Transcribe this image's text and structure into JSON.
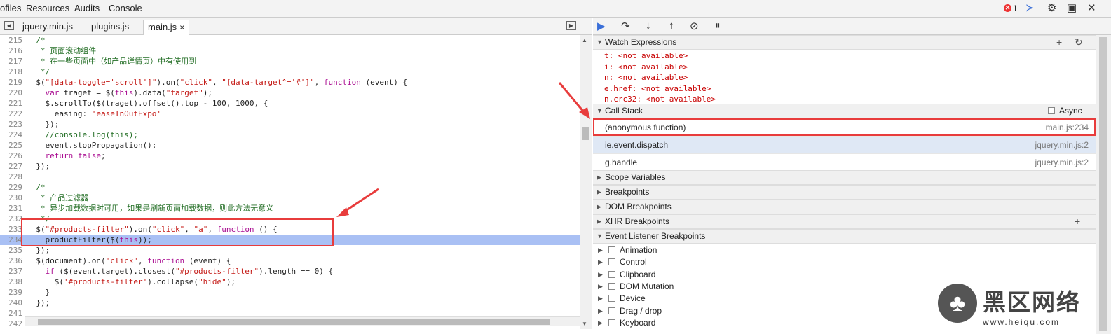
{
  "topbar": {
    "menus": [
      "ofiles",
      "Resources",
      "Audits",
      "Console"
    ],
    "error_count": "1"
  },
  "tabs": [
    "jquery.min.js",
    "plugins.js",
    "main.js"
  ],
  "tab_close": "×",
  "code_lines": [
    {
      "n": "215",
      "t": "  /*"
    },
    {
      "n": "216",
      "t": "   * 页面滚动组件"
    },
    {
      "n": "217",
      "t": "   * 在一些页面中（如产品详情页）中有使用到"
    },
    {
      "n": "218",
      "t": "   */"
    },
    {
      "n": "219",
      "t": "  $(\"[data-toggle='scroll']\").on(\"click\", \"[data-target^='#']\", function (event) {"
    },
    {
      "n": "220",
      "t": "    var traget = $(this).data(\"target\");"
    },
    {
      "n": "221",
      "t": "    $.scrollTo($(traget).offset().top - 100, 1000, {"
    },
    {
      "n": "222",
      "t": "      easing: 'easeInOutExpo'"
    },
    {
      "n": "223",
      "t": "    });"
    },
    {
      "n": "224",
      "t": "    //console.log(this);"
    },
    {
      "n": "225",
      "t": "    event.stopPropagation();"
    },
    {
      "n": "226",
      "t": "    return false;"
    },
    {
      "n": "227",
      "t": "  });"
    },
    {
      "n": "228",
      "t": ""
    },
    {
      "n": "229",
      "t": "  /*"
    },
    {
      "n": "230",
      "t": "   * 产品过滤器"
    },
    {
      "n": "231",
      "t": "   * 异步加载数据时可用，如果是刷新页面加载数据，则此方法无意义"
    },
    {
      "n": "232",
      "t": "   */"
    },
    {
      "n": "233",
      "t": "  $(\"#products-filter\").on(\"click\", \"a\", function () {"
    },
    {
      "n": "234",
      "t": "    productFilter($(this));"
    },
    {
      "n": "235",
      "t": "  });"
    },
    {
      "n": "236",
      "t": "  $(document).on(\"click\", function (event) {"
    },
    {
      "n": "237",
      "t": "    if ($(event.target).closest(\"#products-filter\").length == 0) {"
    },
    {
      "n": "238",
      "t": "      $('#products-filter').collapse(\"hide\");"
    },
    {
      "n": "239",
      "t": "    }"
    },
    {
      "n": "240",
      "t": "  });"
    },
    {
      "n": "241",
      "t": ""
    },
    {
      "n": "242",
      "t": ""
    }
  ],
  "highlighted_line": "234",
  "watch": {
    "title": "Watch Expressions",
    "items": [
      {
        "name": "t:",
        "value": "<not available>"
      },
      {
        "name": "i:",
        "value": "<not available>"
      },
      {
        "name": "n:",
        "value": "<not available>"
      },
      {
        "name": "e.href:",
        "value": "<not available>"
      },
      {
        "name": "n.crc32:",
        "value": "<not available>"
      }
    ]
  },
  "call_stack": {
    "title": "Call Stack",
    "async_label": "Async",
    "frames": [
      {
        "name": "(anonymous function)",
        "loc": "main.js:234"
      },
      {
        "name": "ie.event.dispatch",
        "loc": "jquery.min.js:2"
      },
      {
        "name": "g.handle",
        "loc": "jquery.min.js:2"
      }
    ]
  },
  "sections": {
    "scope": "Scope Variables",
    "breakpoints": "Breakpoints",
    "dom": "DOM Breakpoints",
    "xhr": "XHR Breakpoints",
    "event": "Event Listener Breakpoints"
  },
  "event_items": [
    "Animation",
    "Control",
    "Clipboard",
    "DOM Mutation",
    "Device",
    "Drag / drop",
    "Keyboard"
  ],
  "watermark": {
    "text": "黑区网络",
    "url": "www.heiqu.com"
  },
  "colors": {
    "highlight": "#a9c0f4",
    "annotation": "#e83c3c",
    "error": "#e33333"
  }
}
